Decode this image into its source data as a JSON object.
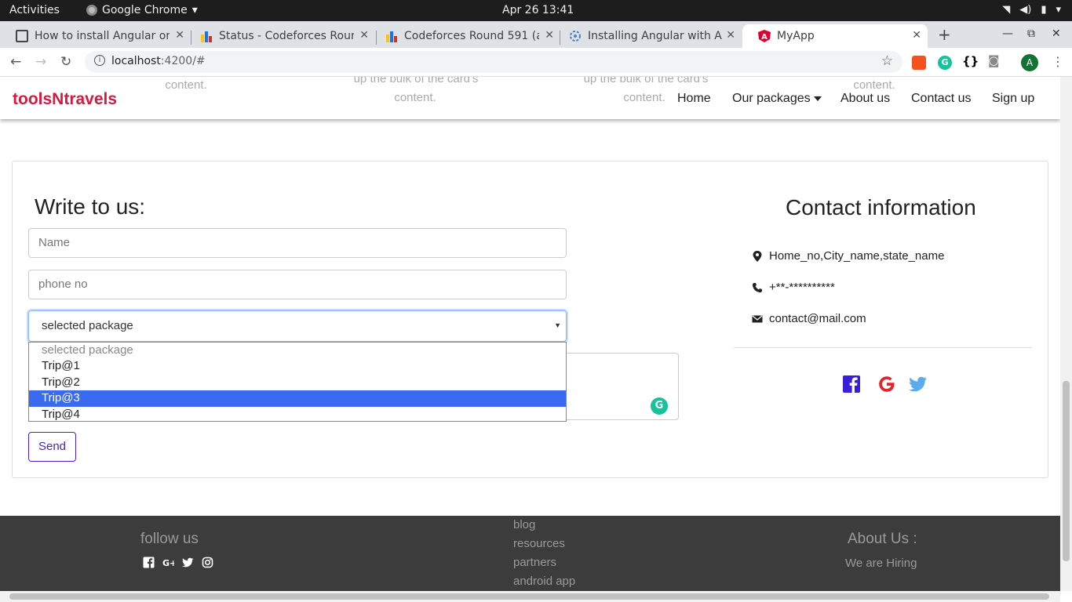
{
  "os": {
    "activities": "Activities",
    "app_name": "Google Chrome",
    "clock": "Apr 26  13:41"
  },
  "tabs": [
    {
      "title": "How to install Angular or",
      "active": false
    },
    {
      "title": "Status - Codeforces Roun",
      "active": false
    },
    {
      "title": "Codeforces Round 591 (a",
      "active": false
    },
    {
      "title": "Installing Angular with A",
      "active": false
    },
    {
      "title": "MyApp",
      "active": true
    }
  ],
  "address": {
    "url_host": "localhost",
    "url_rest": ":4200/#"
  },
  "profile_initial": "A",
  "navbar": {
    "brand": "toolsNtravels",
    "links": [
      "Home",
      "Our packages",
      "About us",
      "Contact us",
      "Sign up"
    ],
    "ghost_text": [
      "content.",
      "up the bulk of the card's",
      "content.",
      "up the bulk of the card's",
      "content.",
      "content."
    ]
  },
  "form": {
    "title": "Write to us:",
    "name_placeholder": "Name",
    "phone_placeholder": "phone no",
    "select_value": "selected package",
    "options": [
      "selected package",
      "Trip@1",
      "Trip@2",
      "Trip@3",
      "Trip@4"
    ],
    "highlighted_option": "Trip@3",
    "send_label": "Send"
  },
  "contact": {
    "title": "Contact information",
    "address": "Home_no,City_name,state_name",
    "phone": "+**-**********",
    "email": "contact@mail.com"
  },
  "footer": {
    "follow": "follow us",
    "links": [
      "blog",
      "resources",
      "partners",
      "android app"
    ],
    "about_title": "About Us :",
    "hiring": "We are Hiring"
  },
  "colors": {
    "brand": "#d6193e",
    "send": "#4b1fc0",
    "facebook": "#3b1fd6",
    "google": "#e8222c",
    "twitter": "#5aacee",
    "footer_bg": "#3c3c3c",
    "highlight": "#3a6af0"
  }
}
